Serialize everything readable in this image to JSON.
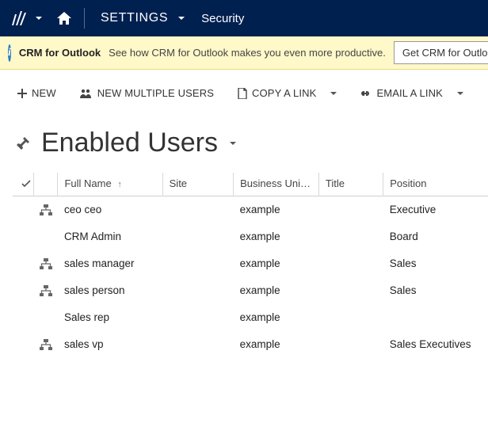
{
  "nav": {
    "settings_label": "SETTINGS",
    "area_label": "Security"
  },
  "infobar": {
    "title": "CRM for Outlook",
    "message": "See how CRM for Outlook makes you even more productive.",
    "button": "Get CRM for Outlook"
  },
  "commands": {
    "new": "NEW",
    "new_multiple": "NEW MULTIPLE USERS",
    "copy_link": "COPY A LINK",
    "email_link": "EMAIL A LINK"
  },
  "view": {
    "title": "Enabled Users"
  },
  "columns": {
    "full_name": "Full Name",
    "site": "Site",
    "business_unit": "Business Unit…",
    "title": "Title",
    "position": "Position"
  },
  "rows": [
    {
      "has_hierarchy": true,
      "full_name": "ceo ceo",
      "site": "",
      "business_unit": "example",
      "title": "",
      "position": "Executive"
    },
    {
      "has_hierarchy": false,
      "full_name": "CRM Admin",
      "site": "",
      "business_unit": "example",
      "title": "",
      "position": "Board"
    },
    {
      "has_hierarchy": true,
      "full_name": "sales manager",
      "site": "",
      "business_unit": "example",
      "title": "",
      "position": "Sales"
    },
    {
      "has_hierarchy": true,
      "full_name": "sales person",
      "site": "",
      "business_unit": "example",
      "title": "",
      "position": "Sales"
    },
    {
      "has_hierarchy": false,
      "full_name": "Sales rep",
      "site": "",
      "business_unit": "example",
      "title": "",
      "position": ""
    },
    {
      "has_hierarchy": true,
      "full_name": "sales vp",
      "site": "",
      "business_unit": "example",
      "title": "",
      "position": "Sales Executives"
    }
  ]
}
